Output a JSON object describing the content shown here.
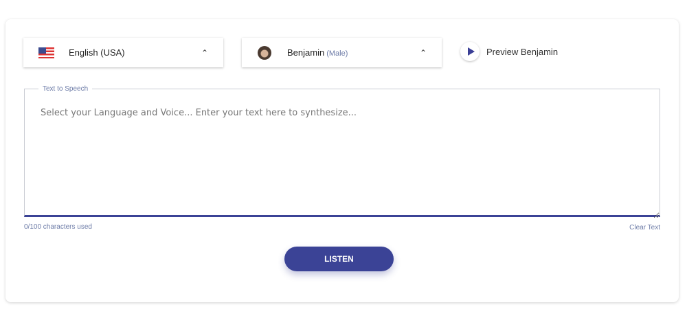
{
  "language": {
    "selected": "English (USA)",
    "flag": "us-flag-icon"
  },
  "voice": {
    "name": "Benjamin",
    "gender": "(Male)"
  },
  "preview": {
    "label": "Preview Benjamin"
  },
  "tts": {
    "legend": "Text to Speech",
    "placeholder": "Select your Language and Voice... Enter your text here to synthesize...",
    "value": ""
  },
  "counter": "0/100 characters used",
  "clear_label": "Clear Text",
  "listen_label": "LISTEN",
  "colors": {
    "accent": "#3b4396"
  }
}
